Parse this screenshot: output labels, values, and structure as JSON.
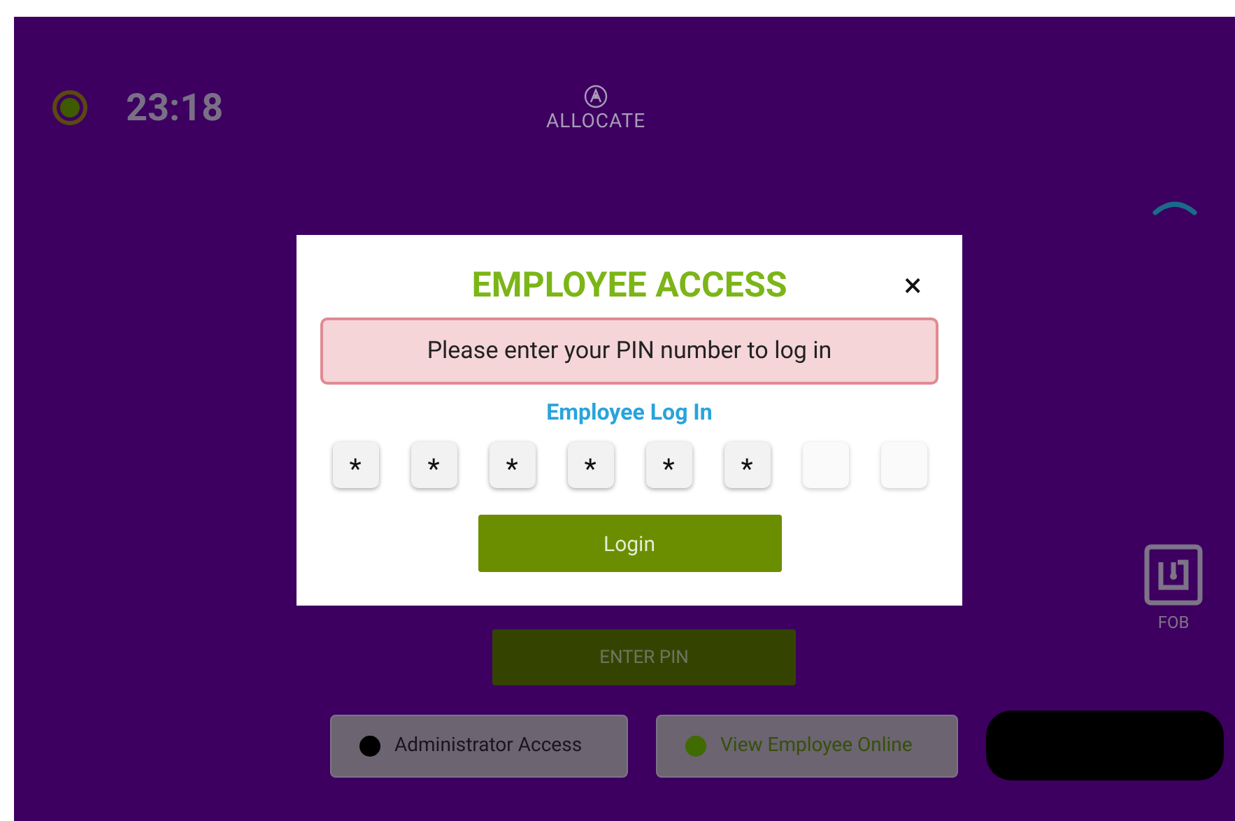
{
  "header": {
    "clock": "23:18",
    "logo": "ALLOCATE"
  },
  "fob": {
    "label": "FOB"
  },
  "enter_pin": {
    "label": "ENTER PIN"
  },
  "bottom_buttons": [
    {
      "label": "Administrator Access",
      "color": "#000000",
      "kind": "button"
    },
    {
      "label": "View Employee Online",
      "color": "#3f6b00",
      "kind": "button"
    },
    {
      "kind": "redacted"
    }
  ],
  "dialog": {
    "title": "EMPLOYEE ACCESS",
    "close": "×",
    "message": "Please enter your PIN number to log in",
    "subtitle": "Employee Log In",
    "pin": [
      {
        "filled": true,
        "value": "*"
      },
      {
        "filled": true,
        "value": "*"
      },
      {
        "filled": true,
        "value": "*"
      },
      {
        "filled": true,
        "value": "*"
      },
      {
        "filled": true,
        "value": "*"
      },
      {
        "filled": true,
        "value": "*"
      },
      {
        "filled": false
      },
      {
        "filled": false
      }
    ],
    "button": "Login"
  }
}
